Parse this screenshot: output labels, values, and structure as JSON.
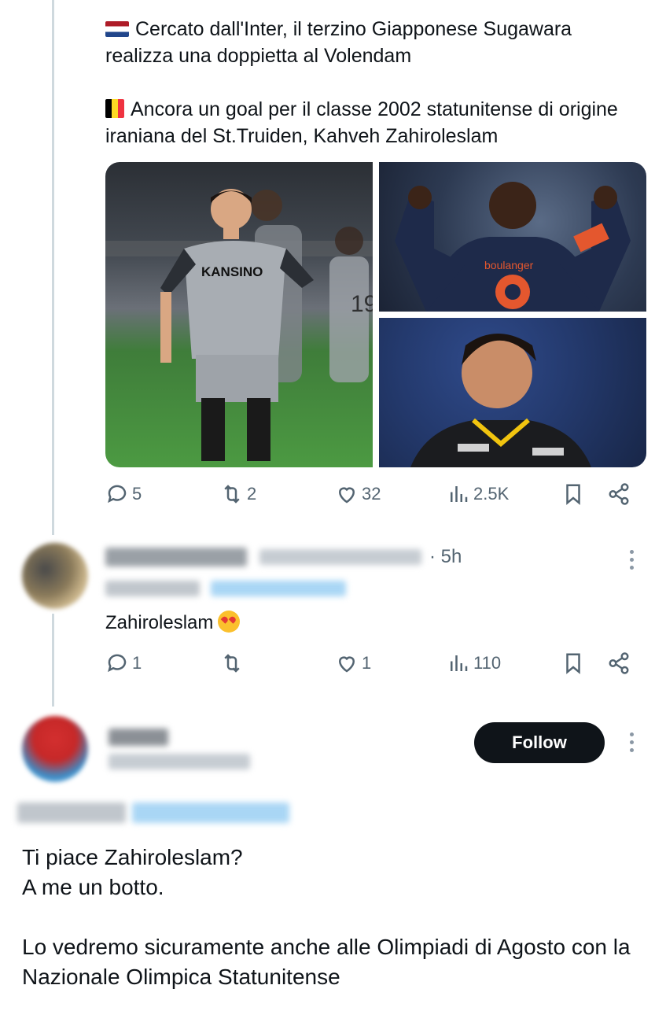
{
  "thread_tweet": {
    "line1_flag": "netherlands-flag",
    "line1": "Cercato dall'Inter, il terzino Giapponese Sugawara realizza una doppietta al Volendam",
    "line2_flag": "belgium-flag",
    "line2": "Ancora un goal per il classe 2002 statunitense di origine iraniana del St.Truiden, Kahveh Zahiroleslam",
    "photos": [
      {
        "jersey_text": "KANSINO",
        "number": "19",
        "colors": [
          "#9ea3a9",
          "#2b2f35",
          "#4c9a42"
        ]
      },
      {
        "jersey_text": "boulanger",
        "colors": [
          "#1e2a4a",
          "#e4572e"
        ]
      },
      {
        "jersey_text": "",
        "colors": [
          "#1b1c1f",
          "#f1c40f"
        ]
      }
    ],
    "stats": {
      "replies": "5",
      "reposts": "2",
      "likes": "32",
      "views": "2.5K"
    }
  },
  "reply": {
    "time": "· 5h",
    "text": "Zahiroleslam",
    "emoji": "heart-eyes-emoji",
    "stats": {
      "replies": "1",
      "reposts": "",
      "likes": "1",
      "views": "110"
    }
  },
  "quoted_post": {
    "follow_label": "Follow",
    "paragraph1": [
      "Ti piace Zahiroleslam?",
      "A me un botto."
    ],
    "paragraph2": "Lo vedremo sicuramente anche alle Olimpiadi di Agosto con la Nazionale Olimpica Statunitense"
  }
}
